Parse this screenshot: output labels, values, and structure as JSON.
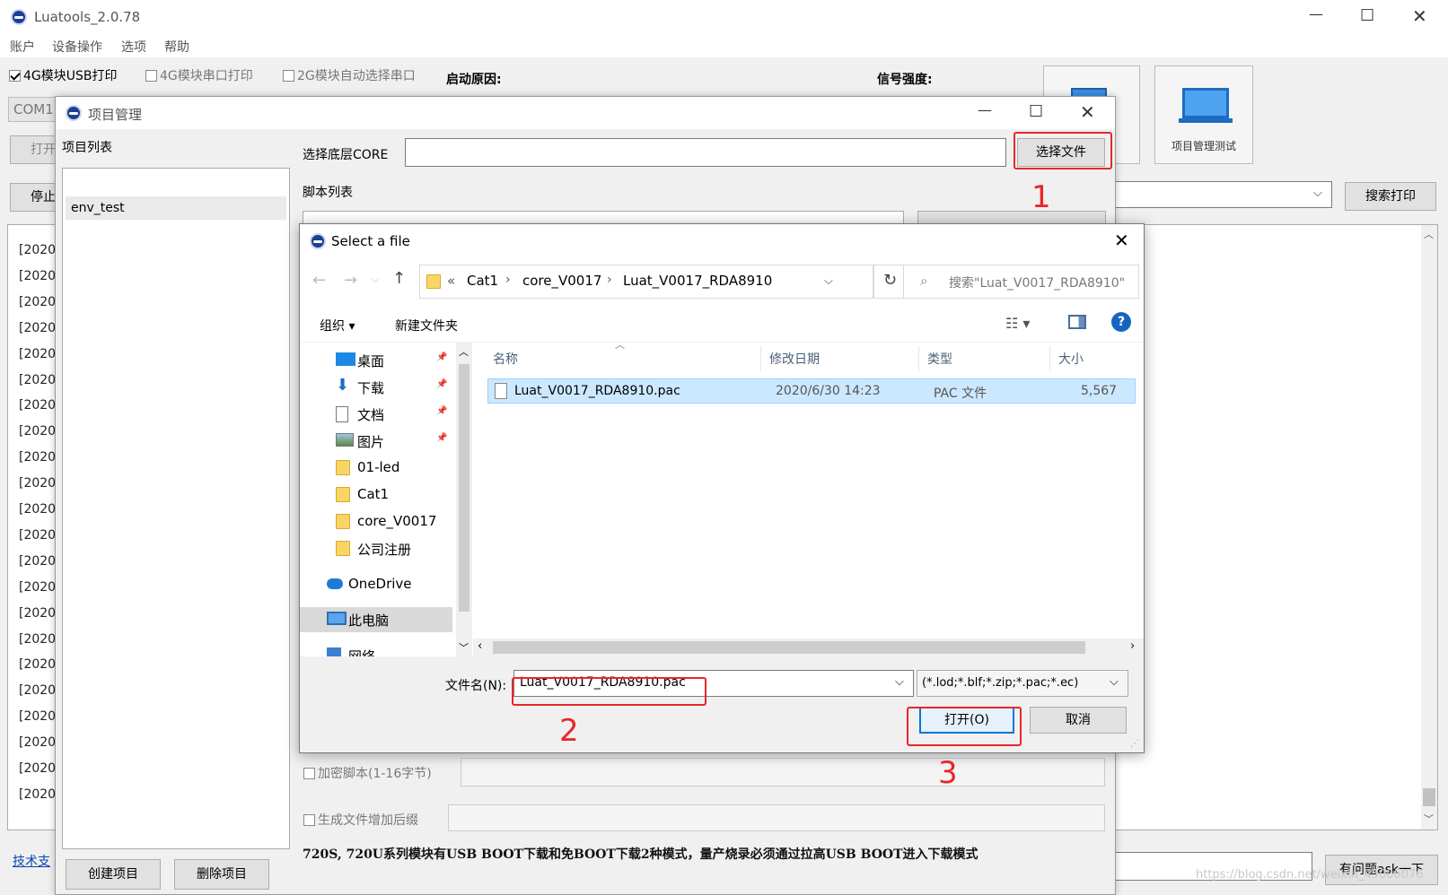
{
  "main": {
    "title": "Luatools_2.0.78",
    "menu": [
      "账户",
      "设备操作",
      "选项",
      "帮助"
    ],
    "options": [
      {
        "label": "4G模块USB打印",
        "checked": true
      },
      {
        "label": "4G模块串口打印",
        "checked": false
      },
      {
        "label": "2G模块自动选择串口",
        "checked": false
      }
    ],
    "boot_reason_label": "启动原因:",
    "signal_label": "信号强度:",
    "com_value": "COM1",
    "open_btn": "打开",
    "stop_btn": "停止",
    "project_test_label": "项目管理测试",
    "search_print_btn": "搜索打印",
    "ask_btn": "有问题ask一下",
    "tech_link": "技术支",
    "log_prefix": "[2020-(",
    "log_count": 22
  },
  "project": {
    "title": "项目管理",
    "list_label": "项目列表",
    "items": [
      "env_test"
    ],
    "core_label": "选择底层CORE",
    "core_value": "",
    "choose_file_btn": "选择文件",
    "script_list_label": "脚本列表",
    "encrypt_label": "加密脚本(1-16字节)",
    "suffix_label": "生成文件增加后缀",
    "notice": "720S, 720U系列模块有USB BOOT下载和免BOOT下载2种模式，量产烧录必须通过拉高USB BOOT进入下载模式",
    "create_btn": "创建项目",
    "delete_btn": "删除项目"
  },
  "file_dialog": {
    "title": "Select a file",
    "breadcrumb": [
      "Cat1",
      "core_V0017",
      "Luat_V0017_RDA8910"
    ],
    "breadcrumb_prefix": "«",
    "search_placeholder": "搜索\"Luat_V0017_RDA8910\"",
    "organize_btn": "组织 ▾",
    "new_folder_btn": "新建文件夹",
    "nav": [
      {
        "label": "桌面",
        "icon": "desktop-icon",
        "pinned": true
      },
      {
        "label": "下载",
        "icon": "download-icon",
        "pinned": true
      },
      {
        "label": "文档",
        "icon": "document-icon",
        "pinned": true
      },
      {
        "label": "图片",
        "icon": "picture-icon",
        "pinned": true
      },
      {
        "label": "01-led",
        "icon": "folder-icon",
        "pinned": false
      },
      {
        "label": "Cat1",
        "icon": "folder-icon",
        "pinned": false
      },
      {
        "label": "core_V0017",
        "icon": "folder-icon",
        "pinned": false
      },
      {
        "label": "公司注册",
        "icon": "folder-icon",
        "pinned": false
      },
      {
        "label": "OneDrive",
        "icon": "cloud-icon",
        "pinned": false
      },
      {
        "label": "此电脑",
        "icon": "computer-icon",
        "pinned": false
      },
      {
        "label": "网络",
        "icon": "network-icon",
        "pinned": false
      }
    ],
    "columns": [
      "名称",
      "修改日期",
      "类型",
      "大小"
    ],
    "files": [
      {
        "name": "Luat_V0017_RDA8910.pac",
        "date": "2020/6/30 14:23",
        "type": "PAC 文件",
        "size": "5,567"
      }
    ],
    "filename_label": "文件名(N):",
    "filename_value": "Luat_V0017_RDA8910.pac",
    "filetype_value": "(*.lod;*.blf;*.zip;*.pac;*.ec)",
    "open_btn": "打开(O)",
    "cancel_btn": "取消"
  },
  "annotations": [
    "1",
    "2",
    "3"
  ],
  "watermark": "https://blog.csdn.net/weixin_45006076",
  "colors": {
    "annotation": "#e8262b",
    "selection": "#cce8ff",
    "accent": "#0078d7"
  }
}
